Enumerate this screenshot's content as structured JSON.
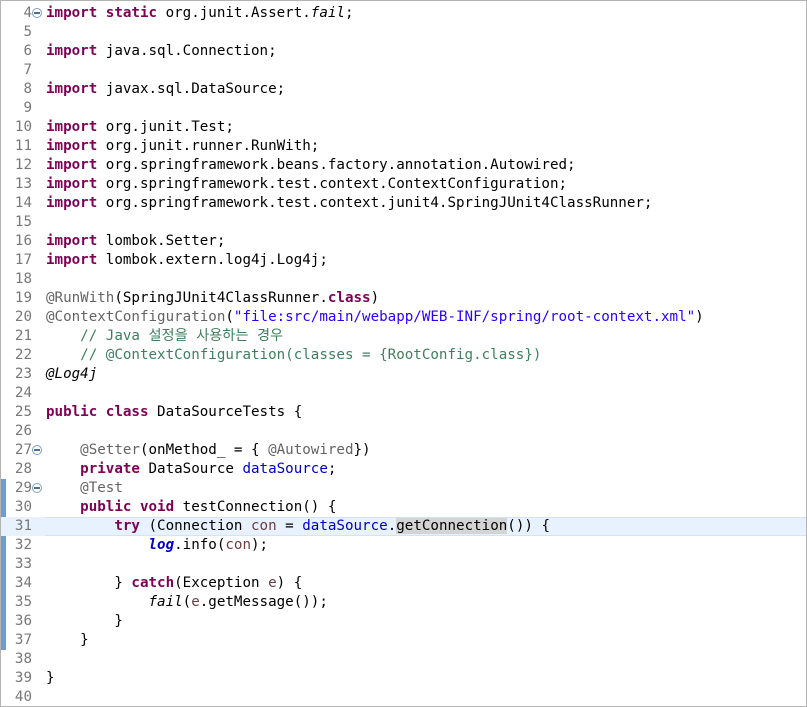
{
  "editor": {
    "current_line": 31,
    "lines": [
      {
        "n": "4",
        "fold": true,
        "tokens": [
          {
            "t": "import",
            "c": "kw"
          },
          {
            "t": " ",
            "c": "plain"
          },
          {
            "t": "static",
            "c": "kw"
          },
          {
            "t": " org.junit.Assert.",
            "c": "plain"
          },
          {
            "t": "fail",
            "c": "italic"
          },
          {
            "t": ";",
            "c": "plain"
          }
        ]
      },
      {
        "n": "5",
        "tokens": []
      },
      {
        "n": "6",
        "tokens": [
          {
            "t": "import",
            "c": "kw"
          },
          {
            "t": " java.sql.Connection;",
            "c": "plain"
          }
        ]
      },
      {
        "n": "7",
        "tokens": []
      },
      {
        "n": "8",
        "tokens": [
          {
            "t": "import",
            "c": "kw"
          },
          {
            "t": " javax.sql.DataSource;",
            "c": "plain"
          }
        ]
      },
      {
        "n": "9",
        "tokens": []
      },
      {
        "n": "10",
        "tokens": [
          {
            "t": "import",
            "c": "kw"
          },
          {
            "t": " org.junit.Test;",
            "c": "plain"
          }
        ]
      },
      {
        "n": "11",
        "tokens": [
          {
            "t": "import",
            "c": "kw"
          },
          {
            "t": " org.junit.runner.RunWith;",
            "c": "plain"
          }
        ]
      },
      {
        "n": "12",
        "tokens": [
          {
            "t": "import",
            "c": "kw"
          },
          {
            "t": " org.springframework.beans.factory.annotation.Autowired;",
            "c": "plain"
          }
        ]
      },
      {
        "n": "13",
        "tokens": [
          {
            "t": "import",
            "c": "kw"
          },
          {
            "t": " org.springframework.test.context.ContextConfiguration;",
            "c": "plain"
          }
        ]
      },
      {
        "n": "14",
        "tokens": [
          {
            "t": "import",
            "c": "kw"
          },
          {
            "t": " org.springframework.test.context.junit4.SpringJUnit4ClassRunner;",
            "c": "plain"
          }
        ]
      },
      {
        "n": "15",
        "tokens": []
      },
      {
        "n": "16",
        "tokens": [
          {
            "t": "import",
            "c": "kw"
          },
          {
            "t": " lombok.Setter;",
            "c": "plain"
          }
        ]
      },
      {
        "n": "17",
        "tokens": [
          {
            "t": "import",
            "c": "kw"
          },
          {
            "t": " lombok.extern.log4j.Log4j;",
            "c": "plain"
          }
        ]
      },
      {
        "n": "18",
        "tokens": []
      },
      {
        "n": "19",
        "tokens": [
          {
            "t": "@RunWith",
            "c": "ann"
          },
          {
            "t": "(SpringJUnit4ClassRunner.",
            "c": "plain"
          },
          {
            "t": "class",
            "c": "kw"
          },
          {
            "t": ")",
            "c": "plain"
          }
        ]
      },
      {
        "n": "20",
        "tokens": [
          {
            "t": "@ContextConfiguration",
            "c": "ann"
          },
          {
            "t": "(",
            "c": "plain"
          },
          {
            "t": "\"file:src/main/webapp/WEB-INF/spring/root-context.xml\"",
            "c": "str"
          },
          {
            "t": ")",
            "c": "plain"
          }
        ]
      },
      {
        "n": "21",
        "tokens": [
          {
            "t": "    // Java 설정을 사용하는 경우",
            "c": "cm"
          }
        ]
      },
      {
        "n": "22",
        "tokens": [
          {
            "t": "    // @ContextConfiguration(classes = {RootConfig.class})",
            "c": "cm"
          }
        ]
      },
      {
        "n": "23",
        "tokens": [
          {
            "t": "@Log4j",
            "c": "italic"
          }
        ]
      },
      {
        "n": "24",
        "tokens": []
      },
      {
        "n": "25",
        "tokens": [
          {
            "t": "public",
            "c": "kw"
          },
          {
            "t": " ",
            "c": "plain"
          },
          {
            "t": "class",
            "c": "kw"
          },
          {
            "t": " DataSourceTests {",
            "c": "plain"
          }
        ]
      },
      {
        "n": "26",
        "tokens": []
      },
      {
        "n": "27",
        "fold": true,
        "tokens": [
          {
            "t": "    ",
            "c": "plain"
          },
          {
            "t": "@Setter",
            "c": "ann"
          },
          {
            "t": "(onMethod_ = { ",
            "c": "plain"
          },
          {
            "t": "@Autowired",
            "c": "ann"
          },
          {
            "t": "})",
            "c": "plain"
          }
        ]
      },
      {
        "n": "28",
        "tokens": [
          {
            "t": "    ",
            "c": "plain"
          },
          {
            "t": "private",
            "c": "kw"
          },
          {
            "t": " DataSource ",
            "c": "plain"
          },
          {
            "t": "dataSource",
            "c": "field"
          },
          {
            "t": ";",
            "c": "plain"
          }
        ]
      },
      {
        "n": "29",
        "fold": true,
        "tokens": [
          {
            "t": "    ",
            "c": "plain"
          },
          {
            "t": "@Test",
            "c": "ann"
          }
        ]
      },
      {
        "n": "30",
        "tokens": [
          {
            "t": "    ",
            "c": "plain"
          },
          {
            "t": "public",
            "c": "kw"
          },
          {
            "t": " ",
            "c": "plain"
          },
          {
            "t": "void",
            "c": "kw"
          },
          {
            "t": " testConnection() {",
            "c": "plain"
          }
        ]
      },
      {
        "n": "31",
        "tokens": [
          {
            "t": "        ",
            "c": "plain"
          },
          {
            "t": "try",
            "c": "kw"
          },
          {
            "t": " (Connection ",
            "c": "plain"
          },
          {
            "t": "con",
            "c": "var"
          },
          {
            "t": " = ",
            "c": "plain"
          },
          {
            "t": "dataSource",
            "c": "field"
          },
          {
            "t": ".",
            "c": "plain"
          },
          {
            "t": "getConnection",
            "c": "hl"
          },
          {
            "t": "()) {",
            "c": "plain"
          }
        ]
      },
      {
        "n": "32",
        "tokens": [
          {
            "t": "            ",
            "c": "plain"
          },
          {
            "t": "log",
            "c": "static-field"
          },
          {
            "t": ".info(",
            "c": "plain"
          },
          {
            "t": "con",
            "c": "var"
          },
          {
            "t": ");",
            "c": "plain"
          }
        ]
      },
      {
        "n": "33",
        "tokens": []
      },
      {
        "n": "34",
        "tokens": [
          {
            "t": "        } ",
            "c": "plain"
          },
          {
            "t": "catch",
            "c": "kw"
          },
          {
            "t": "(Exception ",
            "c": "plain"
          },
          {
            "t": "e",
            "c": "var"
          },
          {
            "t": ") {",
            "c": "plain"
          }
        ]
      },
      {
        "n": "35",
        "tokens": [
          {
            "t": "            ",
            "c": "plain"
          },
          {
            "t": "fail",
            "c": "italic"
          },
          {
            "t": "(",
            "c": "plain"
          },
          {
            "t": "e",
            "c": "var"
          },
          {
            "t": ".getMessage());",
            "c": "plain"
          }
        ]
      },
      {
        "n": "36",
        "tokens": [
          {
            "t": "        }",
            "c": "plain"
          }
        ]
      },
      {
        "n": "37",
        "tokens": [
          {
            "t": "    }",
            "c": "plain"
          }
        ]
      },
      {
        "n": "38",
        "tokens": []
      },
      {
        "n": "39",
        "tokens": [
          {
            "t": "}",
            "c": "plain"
          }
        ]
      },
      {
        "n": "40",
        "tokens": []
      }
    ]
  }
}
